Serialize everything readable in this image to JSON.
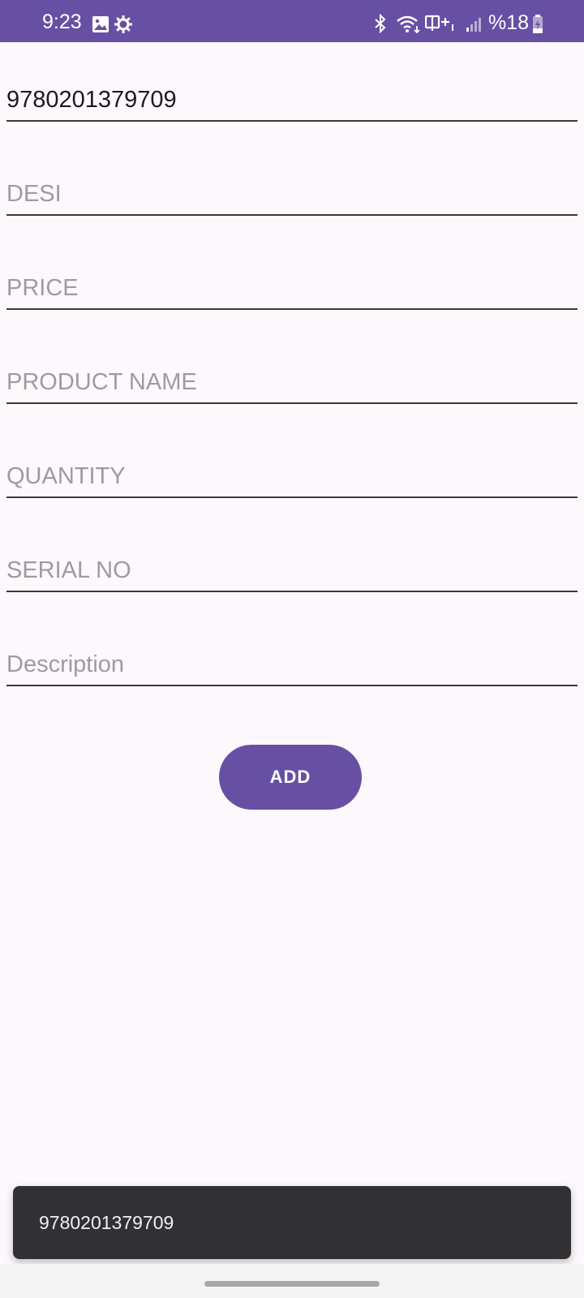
{
  "status_bar": {
    "time": "9:23",
    "battery_text": "%18",
    "icons": [
      "gallery-icon",
      "settings-gear-icon",
      "bluetooth-icon",
      "wifi-icon",
      "volte-icon",
      "signal-icon",
      "battery-charging-icon"
    ]
  },
  "form": {
    "barcode": {
      "value": "9780201379709",
      "placeholder": ""
    },
    "desi": {
      "value": "",
      "placeholder": "DESI"
    },
    "price": {
      "value": "",
      "placeholder": "PRICE"
    },
    "product_name": {
      "value": "",
      "placeholder": "PRODUCT NAME"
    },
    "quantity": {
      "value": "",
      "placeholder": "QUANTITY"
    },
    "serial_no": {
      "value": "",
      "placeholder": "SERIAL NO"
    },
    "description": {
      "value": "",
      "placeholder": "Description"
    }
  },
  "add_button": {
    "label": "ADD"
  },
  "toast": {
    "text": "9780201379709"
  },
  "colors": {
    "primary": "#6750a4",
    "background": "#fdf8fc",
    "toast_bg": "#313033"
  }
}
